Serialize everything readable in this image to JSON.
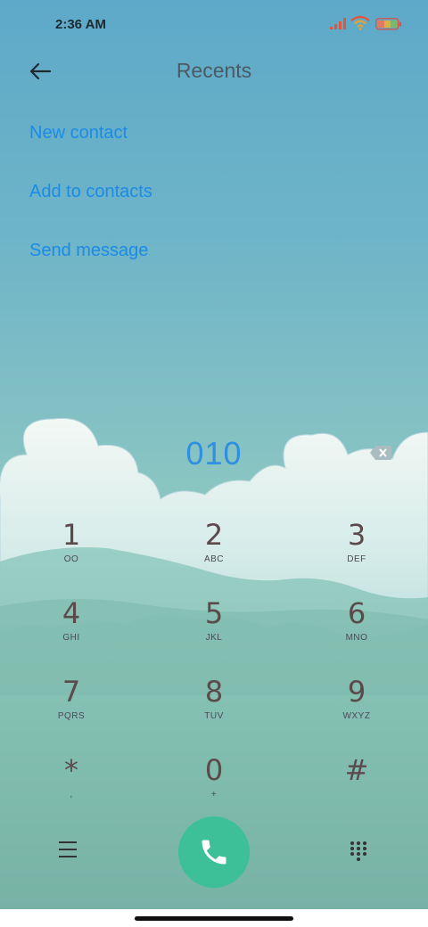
{
  "status_bar": {
    "time": "2:36 AM"
  },
  "header": {
    "title": "Recents"
  },
  "actions": [
    {
      "label": "New contact"
    },
    {
      "label": "Add to contacts"
    },
    {
      "label": "Send message"
    }
  ],
  "dialer": {
    "number": "010",
    "keys": [
      {
        "digit": "1",
        "letters": "OO"
      },
      {
        "digit": "2",
        "letters": "ABC"
      },
      {
        "digit": "3",
        "letters": "DEF"
      },
      {
        "digit": "4",
        "letters": "GHI"
      },
      {
        "digit": "5",
        "letters": "JKL"
      },
      {
        "digit": "6",
        "letters": "MNO"
      },
      {
        "digit": "7",
        "letters": "PQRS"
      },
      {
        "digit": "8",
        "letters": "TUV"
      },
      {
        "digit": "9",
        "letters": "WXYZ"
      },
      {
        "digit": "*",
        "letters": ","
      },
      {
        "digit": "0",
        "letters": "+"
      },
      {
        "digit": "#",
        "letters": ""
      }
    ]
  },
  "icons": {
    "back": "arrow-left-icon",
    "delete": "backspace-icon",
    "menu": "hamburger-icon",
    "call": "phone-icon",
    "keypad": "dialpad-icon"
  },
  "colors": {
    "accent": "#1b8be6",
    "call_button": "#3dbf97",
    "digit": "#5b4a4c"
  }
}
